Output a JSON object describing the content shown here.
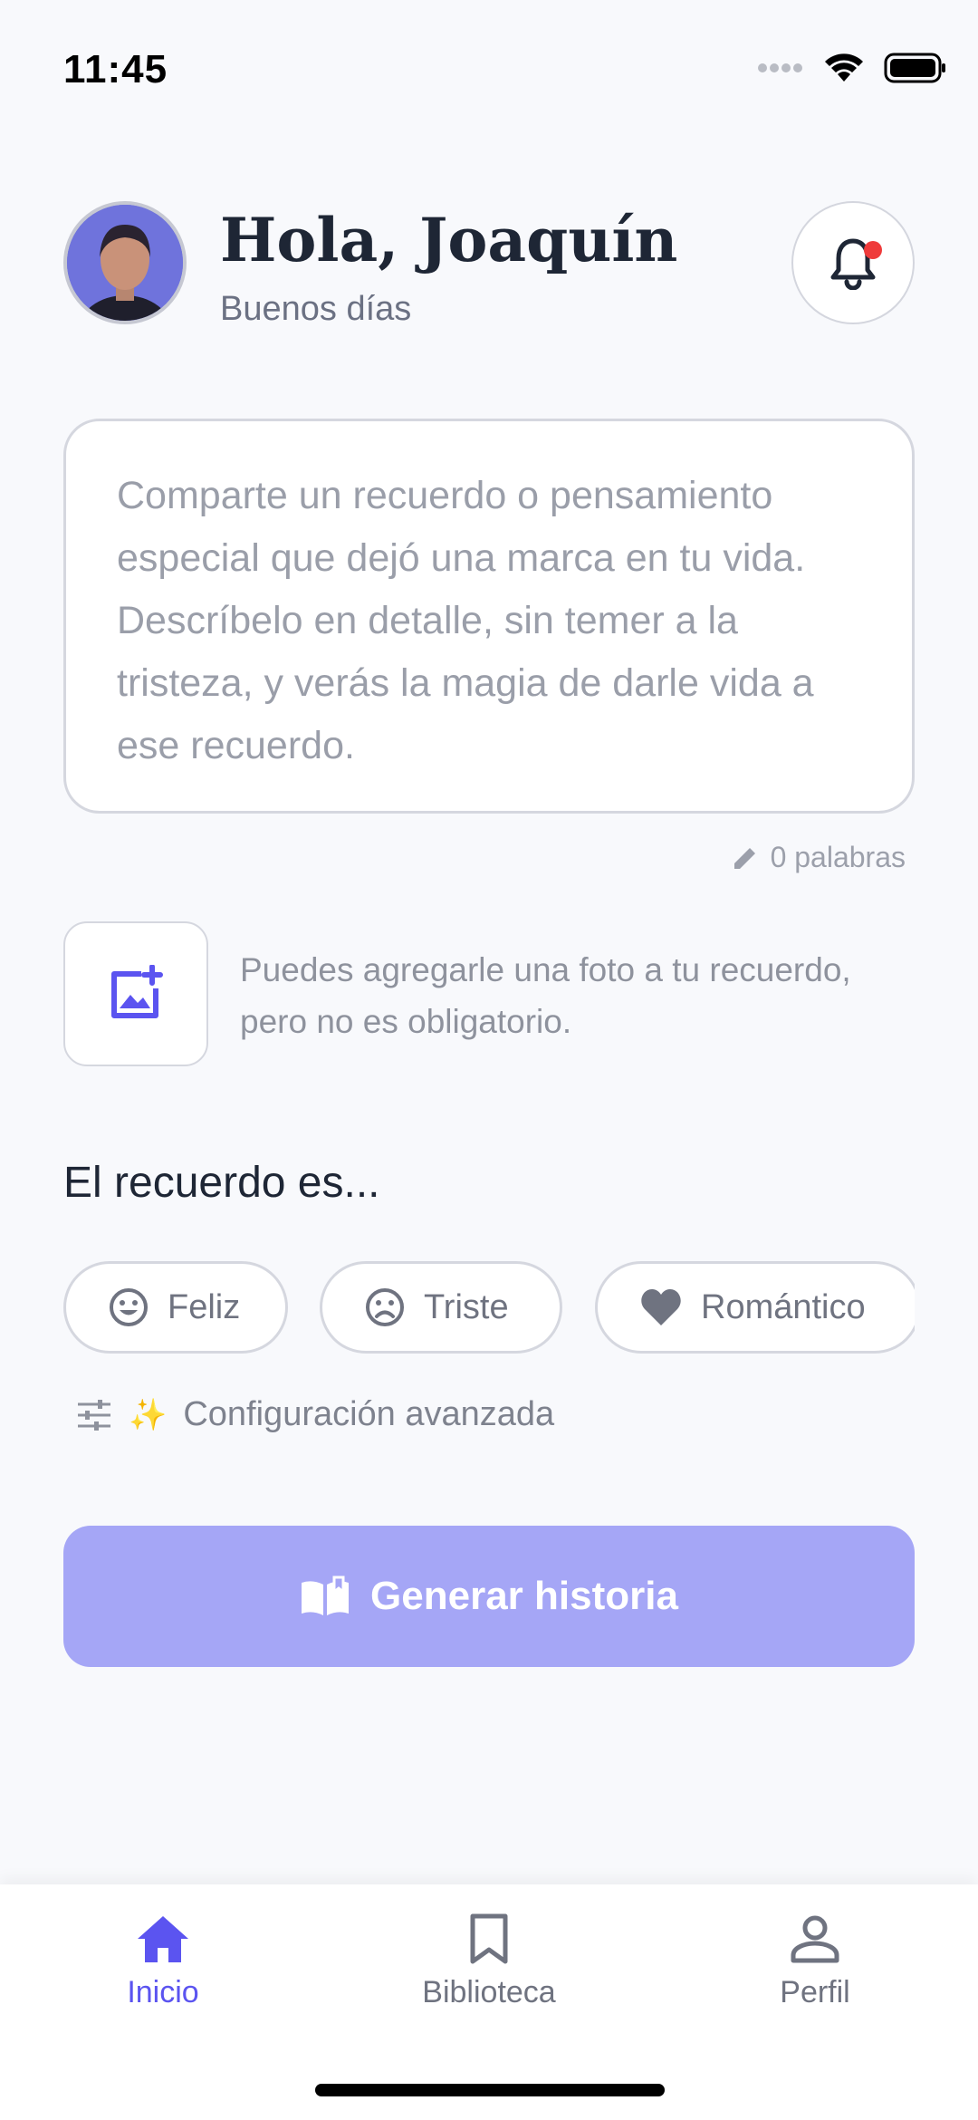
{
  "status_bar": {
    "time": "11:45"
  },
  "header": {
    "greeting": "Hola, Joaquín",
    "subtitle": "Buenos días"
  },
  "composer": {
    "placeholder": "Comparte un recuerdo o pensamiento especial que dejó una marca en tu vida. Descríbelo en detalle, sin temer a la tristeza, y verás la magia de darle vida a ese recuerdo.",
    "word_count": "0 palabras"
  },
  "photo": {
    "hint": "Puedes agregarle una foto a tu recuerdo, pero no es obligatorio."
  },
  "mood": {
    "title": "El recuerdo es...",
    "options": [
      {
        "label": "Feliz",
        "icon": "smile-icon"
      },
      {
        "label": "Triste",
        "icon": "frown-icon"
      },
      {
        "label": "Romántico",
        "icon": "heart-icon"
      }
    ]
  },
  "advanced": {
    "sparkle": "✨",
    "label": "Configuración avanzada"
  },
  "generate": {
    "label": "Generar historia"
  },
  "nav": {
    "items": [
      {
        "label": "Inicio",
        "icon": "home-icon",
        "active": true
      },
      {
        "label": "Biblioteca",
        "icon": "bookmark-icon",
        "active": false
      },
      {
        "label": "Perfil",
        "icon": "person-icon",
        "active": false
      }
    ]
  },
  "colors": {
    "accent": "#5b54f0",
    "button_disabled": "#a5a6f6",
    "notification_dot": "#ef3b3b",
    "background": "#f8f9fc"
  }
}
